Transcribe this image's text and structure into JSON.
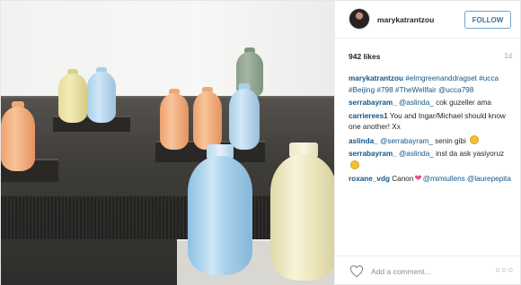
{
  "header": {
    "username": "marykatrantzou",
    "follow_label": "FOLLOW"
  },
  "stats": {
    "likes": "942 likes",
    "age": "1d"
  },
  "comments": [
    {
      "user": "marykatrantzou",
      "text": "#elmgreenanddragset #ucca #Beijing #798 #TheWellfair @ucca798"
    },
    {
      "user": "serrabayram_",
      "mention": "@aslinda_",
      "text": "cok guzeller ama"
    },
    {
      "user": "carrierees1",
      "text": "You and Ingar/Michael should know one another! Xx"
    },
    {
      "user": "aslinda_",
      "mention": "@serrabayram_",
      "text": "senin gibi"
    },
    {
      "user": "serrabayram_",
      "mention": "@aslinda_",
      "text": "inst da ask yasiyoruz"
    },
    {
      "user": "roxane_vdg",
      "text": "Canon",
      "mention": "@mimiullens",
      "mention2": "@laurepepita"
    }
  ],
  "footer": {
    "comment_placeholder": "Add a comment...",
    "like_icon": "heart-outline-icon",
    "more_icon": "more-options-icon"
  },
  "colors": {
    "link": "#125688",
    "follow_border": "#70a6d3",
    "follow_text": "#3f729b"
  }
}
